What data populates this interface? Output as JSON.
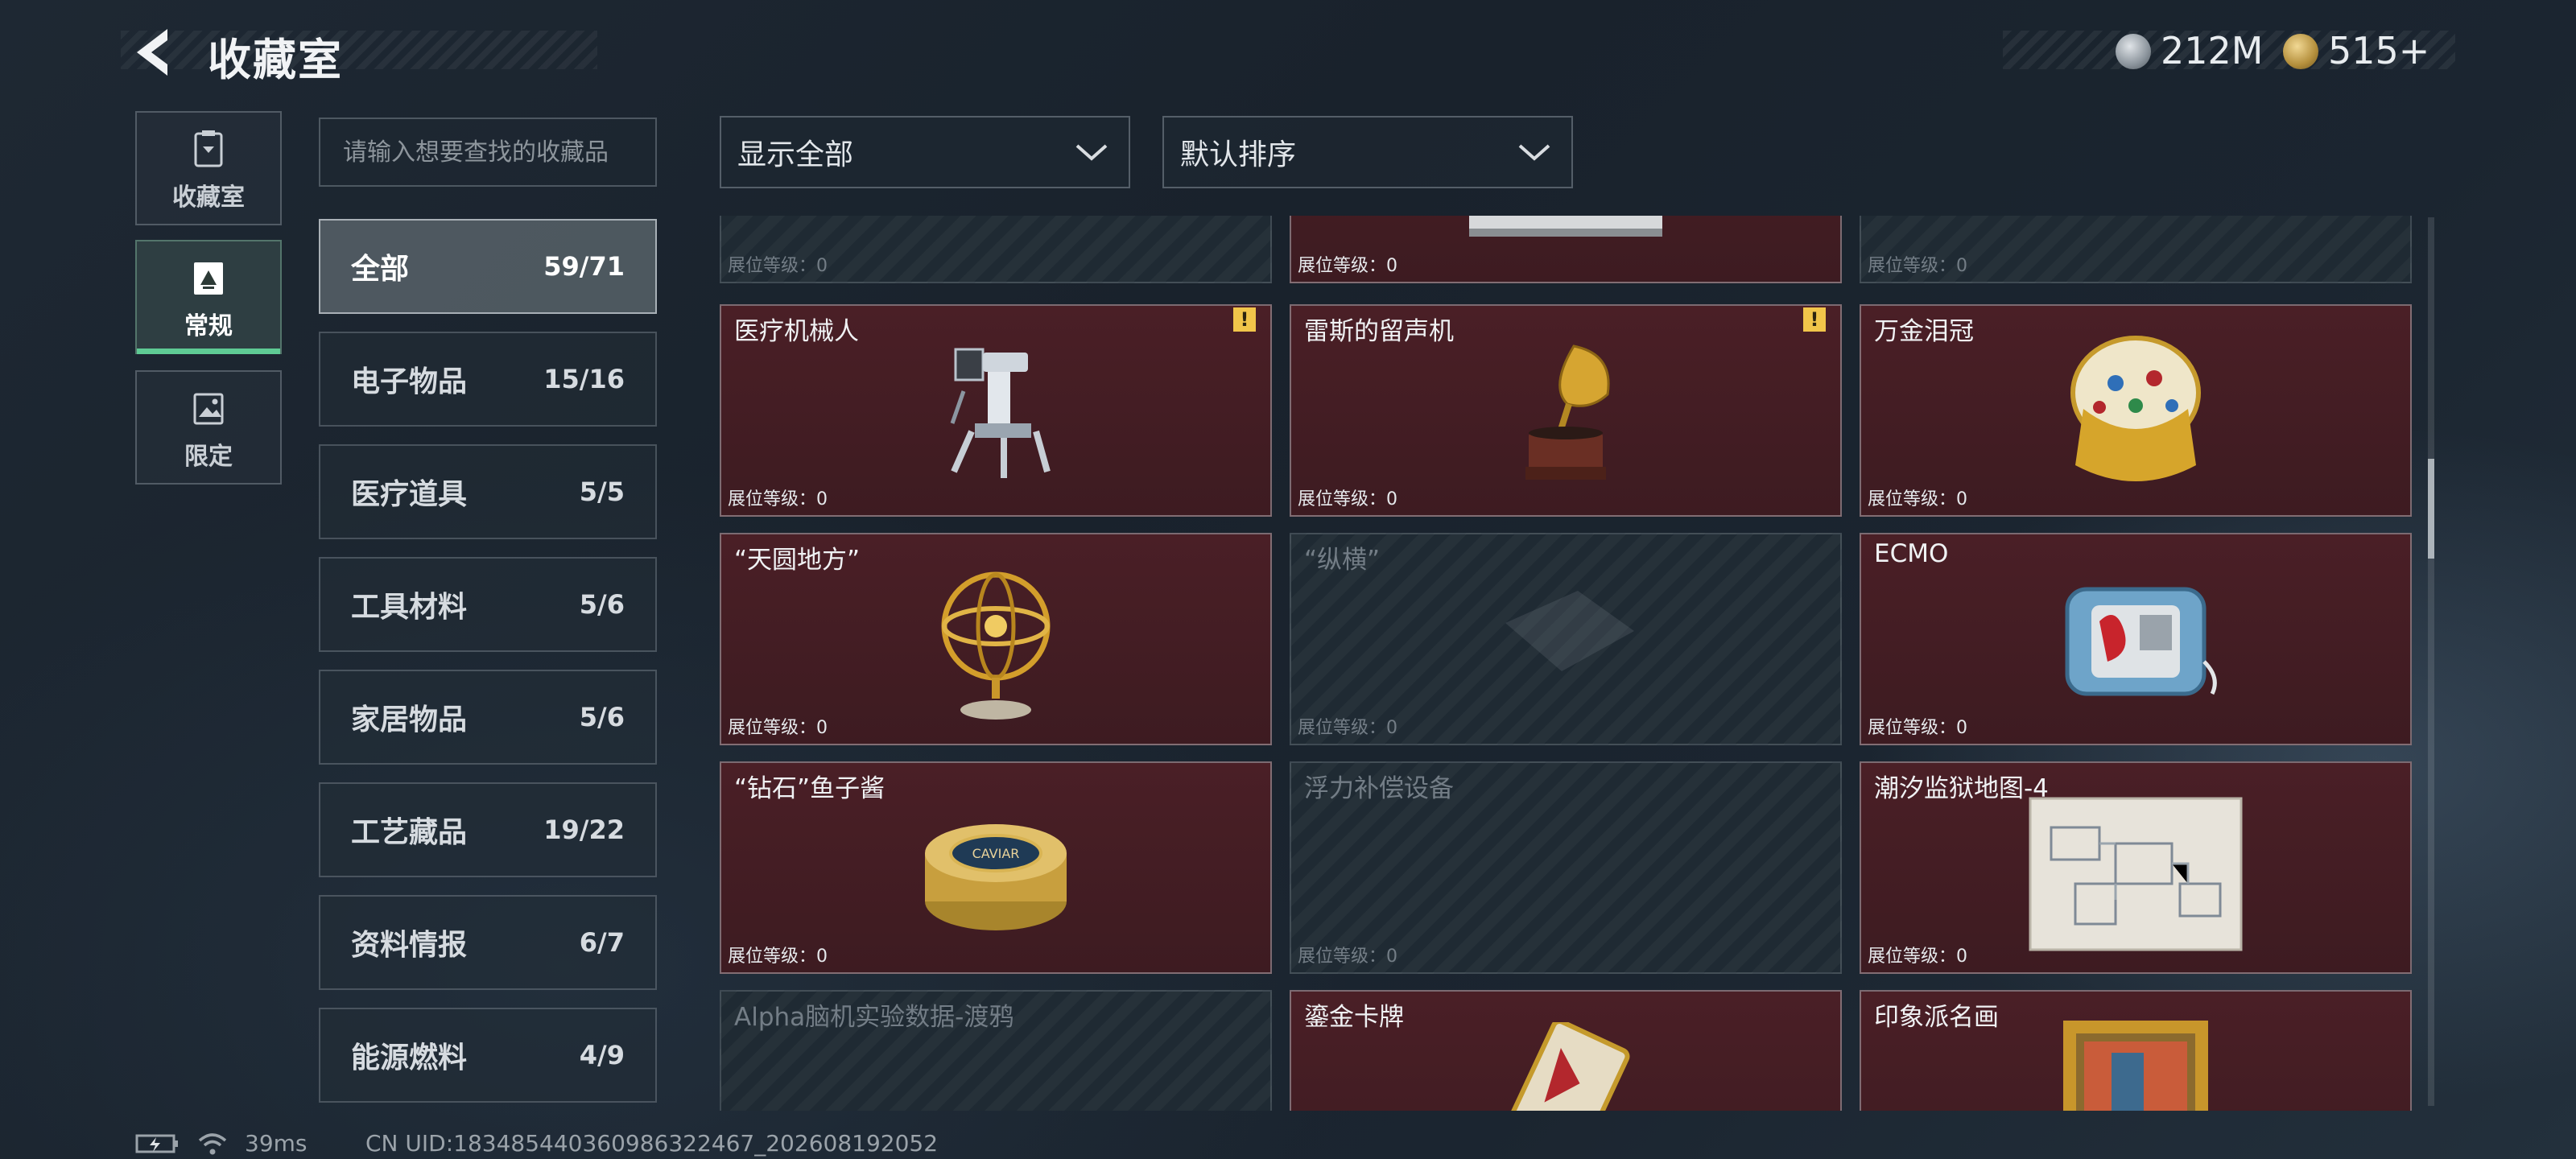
{
  "header": {
    "title": "收藏室"
  },
  "currency": {
    "silver": "212M",
    "gold": "515+"
  },
  "sidebar": {
    "tabs": [
      {
        "label": "收藏室"
      },
      {
        "label": "常规"
      },
      {
        "label": "限定"
      }
    ],
    "active": 1
  },
  "search": {
    "placeholder": "请输入想要查找的收藏品"
  },
  "filters": {
    "show": "显示全部",
    "sort": "默认排序"
  },
  "categories": [
    {
      "name": "全部",
      "count": "59/71"
    },
    {
      "name": "电子物品",
      "count": "15/16"
    },
    {
      "name": "医疗道具",
      "count": "5/5"
    },
    {
      "name": "工具材料",
      "count": "5/6"
    },
    {
      "name": "家居物品",
      "count": "5/6"
    },
    {
      "name": "工艺藏品",
      "count": "19/22"
    },
    {
      "name": "资料情报",
      "count": "6/7"
    },
    {
      "name": "能源燃料",
      "count": "4/9"
    }
  ],
  "items": [
    {
      "name": "",
      "level": "展位等级：0",
      "owned": false
    },
    {
      "name": "",
      "level": "展位等级：0",
      "owned": true
    },
    {
      "name": "",
      "level": "展位等级：0",
      "owned": false
    },
    {
      "name": "医疗机械人",
      "level": "展位等级：0",
      "owned": true,
      "warn": true
    },
    {
      "name": "雷斯的留声机",
      "level": "展位等级：0",
      "owned": true,
      "warn": true
    },
    {
      "name": "万金泪冠",
      "level": "展位等级：0",
      "owned": true
    },
    {
      "name": "“天圆地方”",
      "level": "展位等级：0",
      "owned": true
    },
    {
      "name": "“纵横”",
      "level": "展位等级：0",
      "owned": false
    },
    {
      "name": "ECMO",
      "level": "展位等级：0",
      "owned": true
    },
    {
      "name": "“钻石”鱼子酱",
      "level": "展位等级：0",
      "owned": true
    },
    {
      "name": "浮力补偿设备",
      "level": "展位等级：0",
      "owned": false
    },
    {
      "name": "潮汐监狱地图-4",
      "level": "展位等级：0",
      "owned": true
    },
    {
      "name": "Alpha脑机实验数据-渡鸦",
      "level": "",
      "owned": false
    },
    {
      "name": "鎏金卡牌",
      "level": "",
      "owned": true
    },
    {
      "name": "印象派名画",
      "level": "",
      "owned": true
    }
  ],
  "warn_mark": "!",
  "status": {
    "ping": "39ms",
    "uid": "CN UID:1834854403609863224​67_202608192052"
  },
  "colors": {
    "accent": "#5ecb94",
    "owned_card": "#4a1f26",
    "warn": "#f1c54a"
  }
}
